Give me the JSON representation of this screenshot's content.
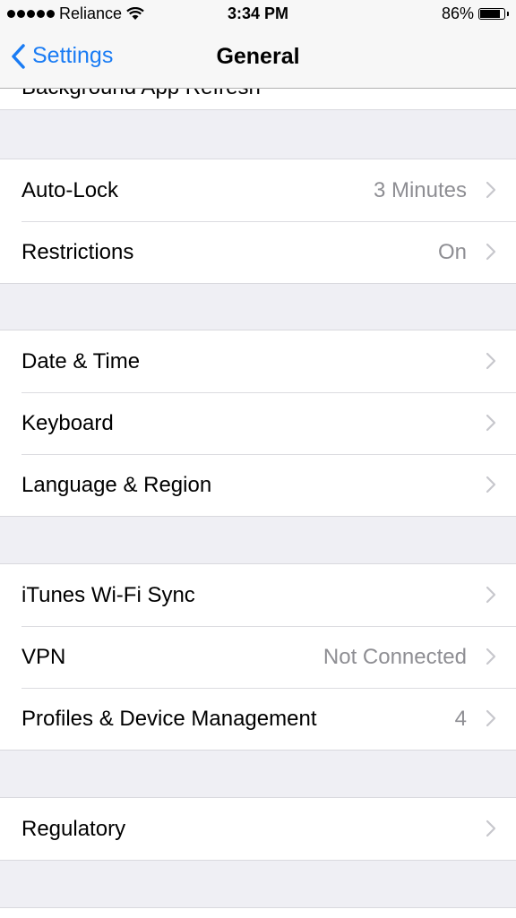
{
  "status_bar": {
    "carrier": "Reliance",
    "time": "3:34 PM",
    "battery": "86%",
    "battery_level": 0.86,
    "signal_bars": 5
  },
  "nav": {
    "back_label": "Settings",
    "title": "General",
    "accent": "#1a7cf4"
  },
  "partial_row_label": "Background App Refresh",
  "groups": [
    [
      {
        "label": "Auto-Lock",
        "value": "3 Minutes"
      },
      {
        "label": "Restrictions",
        "value": "On"
      }
    ],
    [
      {
        "label": "Date & Time",
        "value": ""
      },
      {
        "label": "Keyboard",
        "value": ""
      },
      {
        "label": "Language & Region",
        "value": ""
      }
    ],
    [
      {
        "label": "iTunes Wi-Fi Sync",
        "value": ""
      },
      {
        "label": "VPN",
        "value": "Not Connected"
      },
      {
        "label": "Profiles & Device Management",
        "value": "4"
      }
    ],
    [
      {
        "label": "Regulatory",
        "value": ""
      }
    ]
  ]
}
